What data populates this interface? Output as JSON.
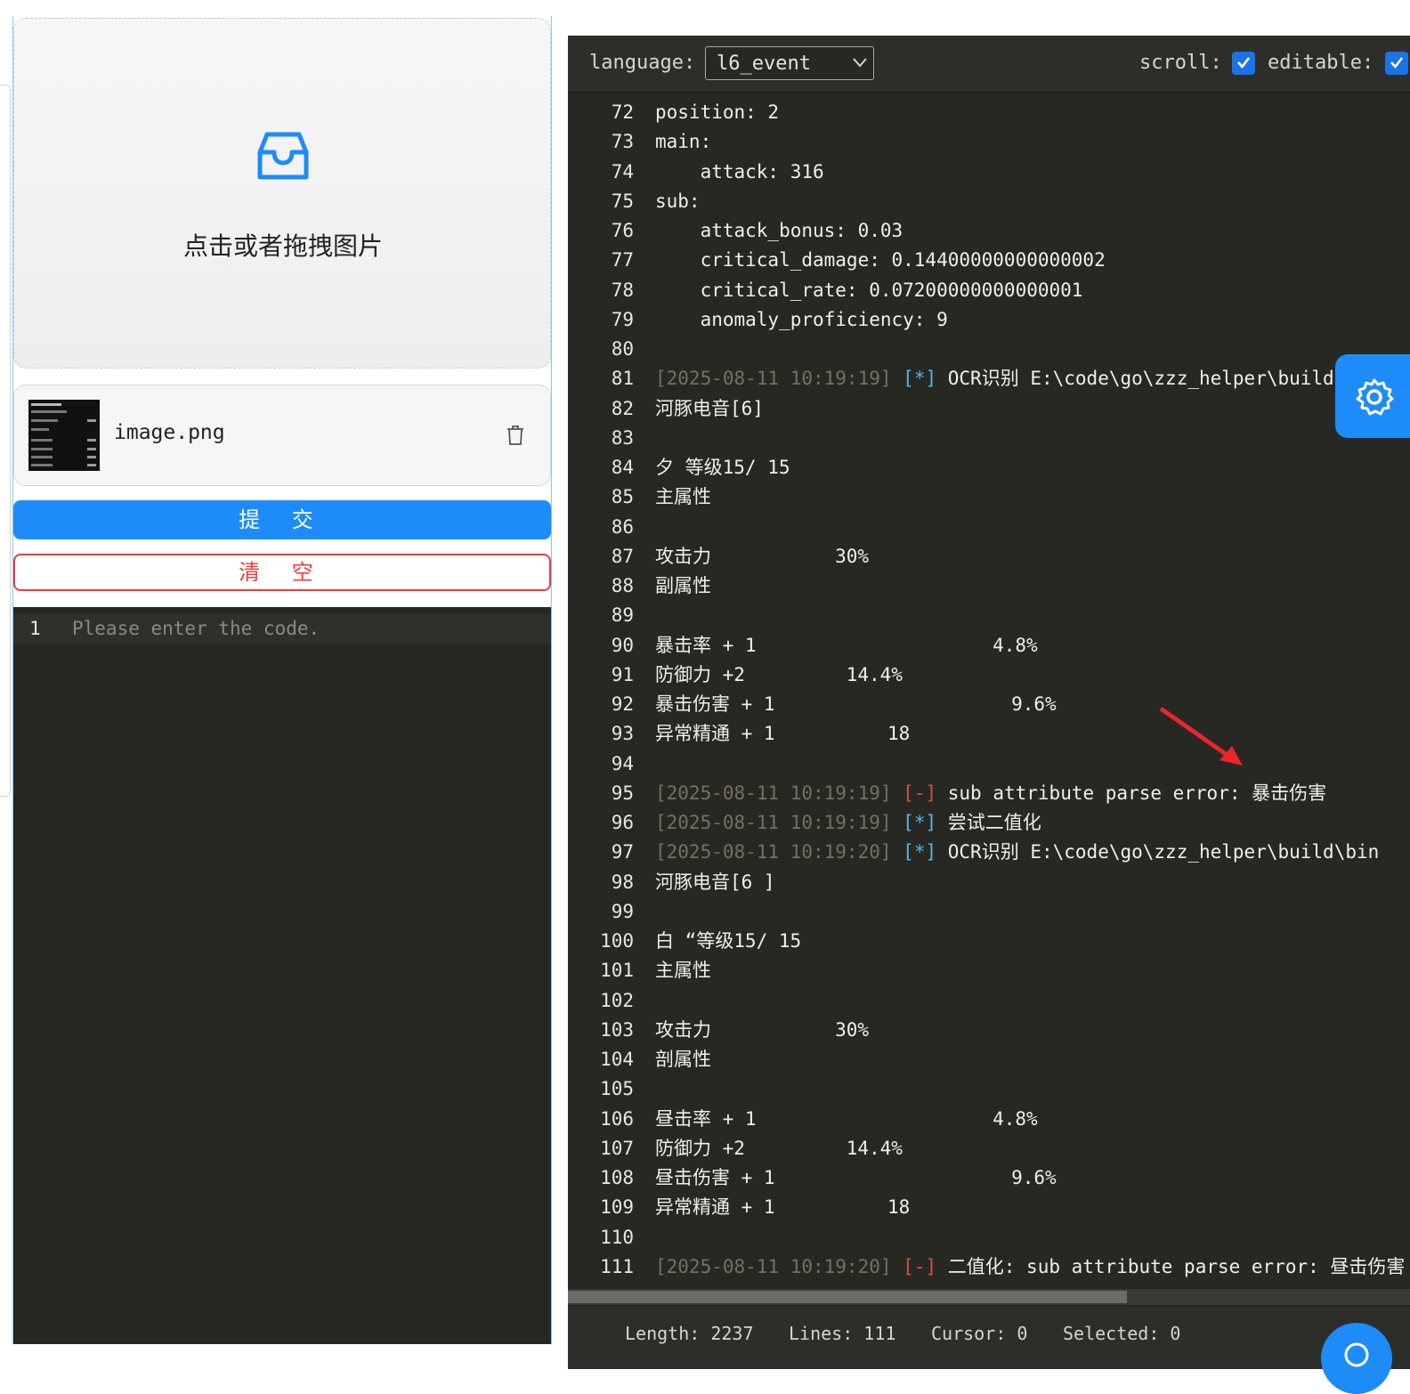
{
  "upload": {
    "prompt": "点击或者拖拽图片",
    "file_name": "image.png"
  },
  "buttons": {
    "submit": "提 交",
    "clear": "清 空"
  },
  "left_editor": {
    "line_number": "1",
    "placeholder": "Please enter the code."
  },
  "toolbar": {
    "language_label": "language:",
    "language_value": "l6_event",
    "scroll_label": "scroll:",
    "editable_label": "editable:"
  },
  "code_lines": [
    {
      "n": "72",
      "text": "position: 2"
    },
    {
      "n": "73",
      "text": "main:"
    },
    {
      "n": "74",
      "text": "    attack: 316"
    },
    {
      "n": "75",
      "text": "sub:"
    },
    {
      "n": "76",
      "text": "    attack_bonus: 0.03"
    },
    {
      "n": "77",
      "text": "    critical_damage: 0.14400000000000002"
    },
    {
      "n": "78",
      "text": "    critical_rate: 0.07200000000000001"
    },
    {
      "n": "79",
      "text": "    anomaly_proficiency: 9"
    },
    {
      "n": "80",
      "text": ""
    },
    {
      "n": "81",
      "ts": "[2025-08-11 10:19:19]",
      "tag": "[*]",
      "tag_type": "info",
      "text": "OCR识别 E:\\code\\go\\zzz_helper\\build\\bin"
    },
    {
      "n": "82",
      "text": "河豚电音[6]"
    },
    {
      "n": "83",
      "text": ""
    },
    {
      "n": "84",
      "text": "夕 等级15/ 15"
    },
    {
      "n": "85",
      "text": "主属性"
    },
    {
      "n": "86",
      "text": ""
    },
    {
      "n": "87",
      "text": "攻击力           30%"
    },
    {
      "n": "88",
      "text": "副属性"
    },
    {
      "n": "89",
      "text": ""
    },
    {
      "n": "90",
      "text": "暴击率 + 1                     4.8%"
    },
    {
      "n": "91",
      "text": "防御力 +2         14.4%"
    },
    {
      "n": "92",
      "text": "暴击伤害 + 1                     9.6%"
    },
    {
      "n": "93",
      "text": "异常精通 + 1          18"
    },
    {
      "n": "94",
      "text": ""
    },
    {
      "n": "95",
      "ts": "[2025-08-11 10:19:19]",
      "tag": "[-]",
      "tag_type": "err",
      "text": "sub attribute parse error: 暴击伤害"
    },
    {
      "n": "96",
      "ts": "[2025-08-11 10:19:19]",
      "tag": "[*]",
      "tag_type": "info",
      "text": "尝试二值化"
    },
    {
      "n": "97",
      "ts": "[2025-08-11 10:19:20]",
      "tag": "[*]",
      "tag_type": "info",
      "text": "OCR识别 E:\\code\\go\\zzz_helper\\build\\bin"
    },
    {
      "n": "98",
      "text": "河豚电音[6 ]"
    },
    {
      "n": "99",
      "text": ""
    },
    {
      "n": "100",
      "text": "白 “等级15/ 15"
    },
    {
      "n": "101",
      "text": "主属性"
    },
    {
      "n": "102",
      "text": ""
    },
    {
      "n": "103",
      "text": "攻击力           30%"
    },
    {
      "n": "104",
      "text": "剖属性"
    },
    {
      "n": "105",
      "text": ""
    },
    {
      "n": "106",
      "text": "昼击率 + 1                     4.8%"
    },
    {
      "n": "107",
      "text": "防御力 +2         14.4%"
    },
    {
      "n": "108",
      "text": "昼击伤害 + 1                     9.6%"
    },
    {
      "n": "109",
      "text": "异常精通 + 1          18"
    },
    {
      "n": "110",
      "text": ""
    },
    {
      "n": "111",
      "ts": "[2025-08-11 10:19:20]",
      "tag": "[-]",
      "tag_type": "err",
      "text": "二值化: sub attribute parse error: 昼击伤害"
    }
  ],
  "status": {
    "length": "Length: 2237",
    "lines": "Lines: 111",
    "cursor": "Cursor: 0",
    "selected": "Selected: 0"
  },
  "colors": {
    "primary": "#1d8cf8",
    "danger": "#ee3b3b",
    "editor_bg": "#272822",
    "annotation_arrow": "#e8262b"
  },
  "icons": {
    "upload": "inbox-icon",
    "delete": "trash-icon",
    "settings": "gear-icon",
    "chat": "chat-icon",
    "dropdown": "chevron-down-icon"
  }
}
